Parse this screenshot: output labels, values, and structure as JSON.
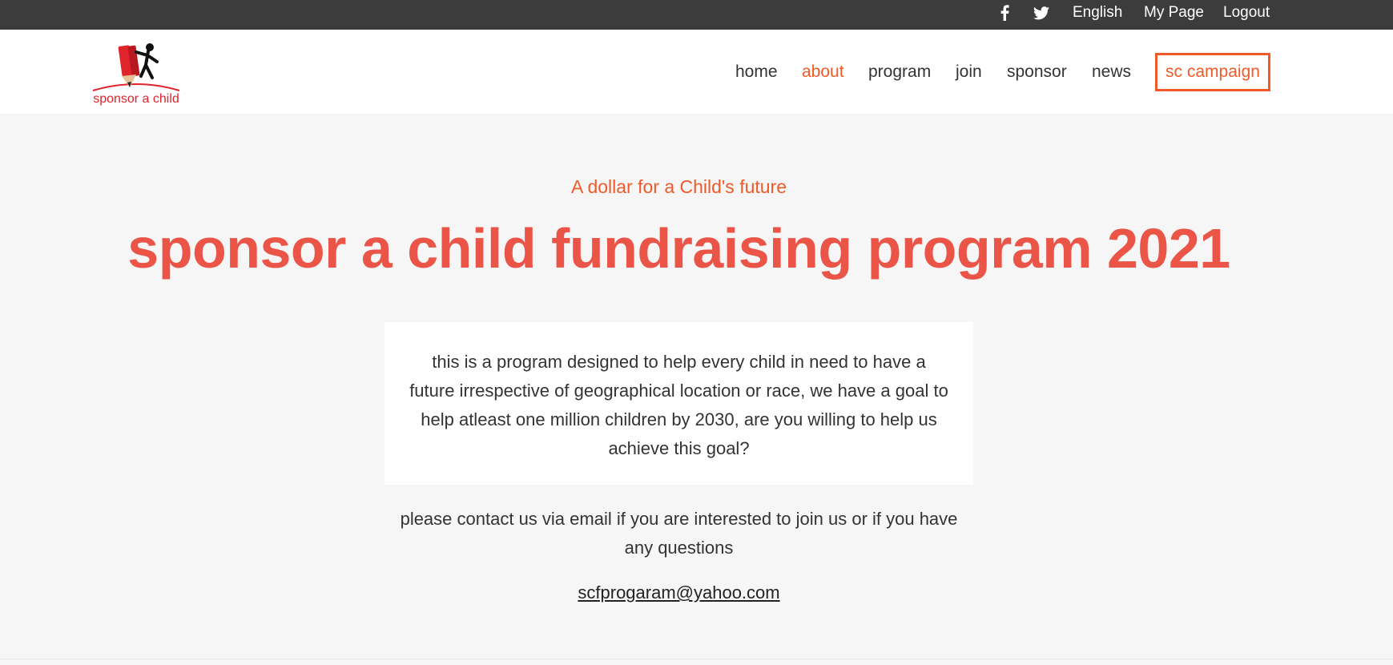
{
  "topbar": {
    "icons": [
      "facebook-icon",
      "twitter-icon"
    ],
    "language": "English",
    "my_page": "My Page",
    "logout": "Logout"
  },
  "logo": {
    "text": "sponsor a child"
  },
  "nav": {
    "home": "home",
    "about": "about",
    "program": "program",
    "join": "join",
    "sponsor": "sponsor",
    "news": "news",
    "campaign": "sc campaign",
    "active": "about"
  },
  "main": {
    "tagline": "A dollar for a Child's future",
    "headline": "sponsor a child fundraising program 2021",
    "description": "this is a program designed to help every child in need to have a future irrespective of geographical location or race, we have a goal to help atleast one million children by 2030, are you willing to help us achieve this goal?",
    "contact": "please contact us via email if you are interested to join us or if you have any questions",
    "email": "scfprogaram@yahoo.com"
  },
  "colors": {
    "accent": "#f05a28",
    "headline": "#eb5548",
    "topbar": "#3c3c3c",
    "background": "#f6f6f6"
  }
}
